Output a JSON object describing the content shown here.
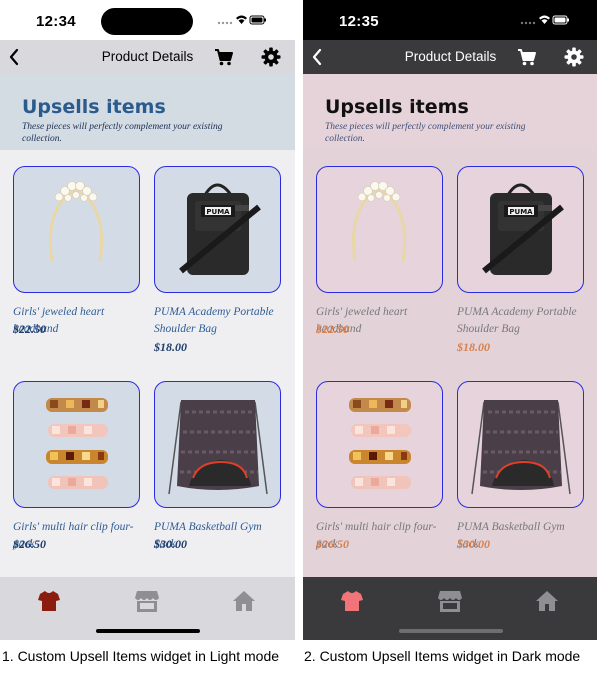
{
  "status_time_light": "12:34",
  "status_time_dark": "12:35",
  "navbar": {
    "title": "Product Details"
  },
  "upsells": {
    "title": "Upsells items",
    "subtitle": "These pieces will perfectly complement your existing collection."
  },
  "products": [
    {
      "name": "Girls' jeweled heart headband",
      "price": "$22.50"
    },
    {
      "name": "PUMA Academy Portable Shoulder Bag",
      "price": "$18.00"
    },
    {
      "name": "Girls' multi hair clip four-pack",
      "price": "$26.50"
    },
    {
      "name": "PUMA Basketball Gym Sack",
      "price": "$30.00"
    }
  ],
  "product_image_icons": [
    "headband-image",
    "shoulder-bag-image",
    "hair-clips-image",
    "gym-sack-image"
  ],
  "bag_logo_text": "PUMA",
  "tabbar": {
    "icons": [
      "shirt-icon",
      "store-icon",
      "home-icon"
    ]
  },
  "captions": {
    "light": "1. Custom Upsell Items widget in Light mode",
    "dark": "2. Custom Upsell Items widget in Dark mode"
  },
  "colors": {
    "card_border": "#2a2ae0",
    "light_title": "#2b5b8c",
    "dark_price": "#d8804c",
    "light_active_tab": "#8a1c10",
    "dark_active_tab": "#f07478"
  }
}
